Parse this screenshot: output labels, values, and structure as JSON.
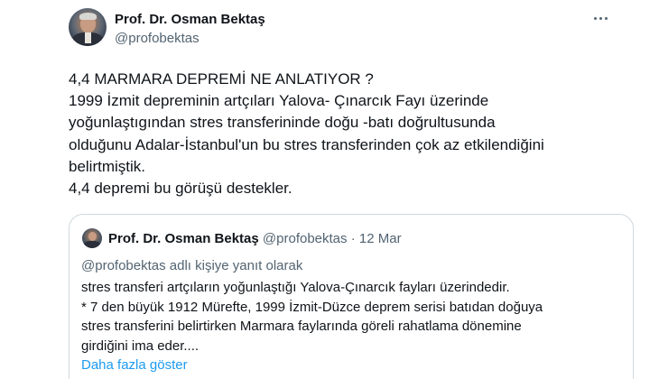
{
  "tweet": {
    "author": {
      "display_name": "Prof. Dr. Osman Bektaş",
      "handle": "@profobektas"
    },
    "text_lines": [
      "4,4 MARMARA DEPREMİ NE ANLATIYOR ?",
      "1999 İzmit depreminin artçıları Yalova- Çınarcık Fayı üzerinde",
      "yoğunlaştıgından stres transferininde doğu -batı doğrultusunda",
      "olduğunu Adalar-İstanbul'un bu stres transferinden çok az etkilendiğini",
      "belirtmiştik.",
      "4,4 depremi bu görüşü destekler."
    ]
  },
  "quoted_tweet": {
    "display_name": "Prof. Dr. Osman Bektaş",
    "handle": "@profobektas",
    "separator": "·",
    "date": "12 Mar",
    "reply_context": "@profobektas adlı kişiye yanıt olarak",
    "text_lines": [
      "stres transferi artçıların yoğunlaştığı Yalova-Çınarcık fayları üzerindedir.",
      "* 7 den büyük 1912 Mürefte, 1999 İzmit-Düzce deprem serisi batıdan doğuya",
      "stres transferini belirtirken Marmara faylarında göreli rahatlama dönemine",
      "girdiğini ima eder...."
    ],
    "show_more_label": "Daha fazla göster"
  },
  "icons": {
    "more": "more-horizontal-icon",
    "avatar": "profile-photo"
  },
  "colors": {
    "text_primary": "#0f1419",
    "text_secondary": "#536471",
    "link": "#1d9bf0",
    "border": "#cfd9de"
  }
}
